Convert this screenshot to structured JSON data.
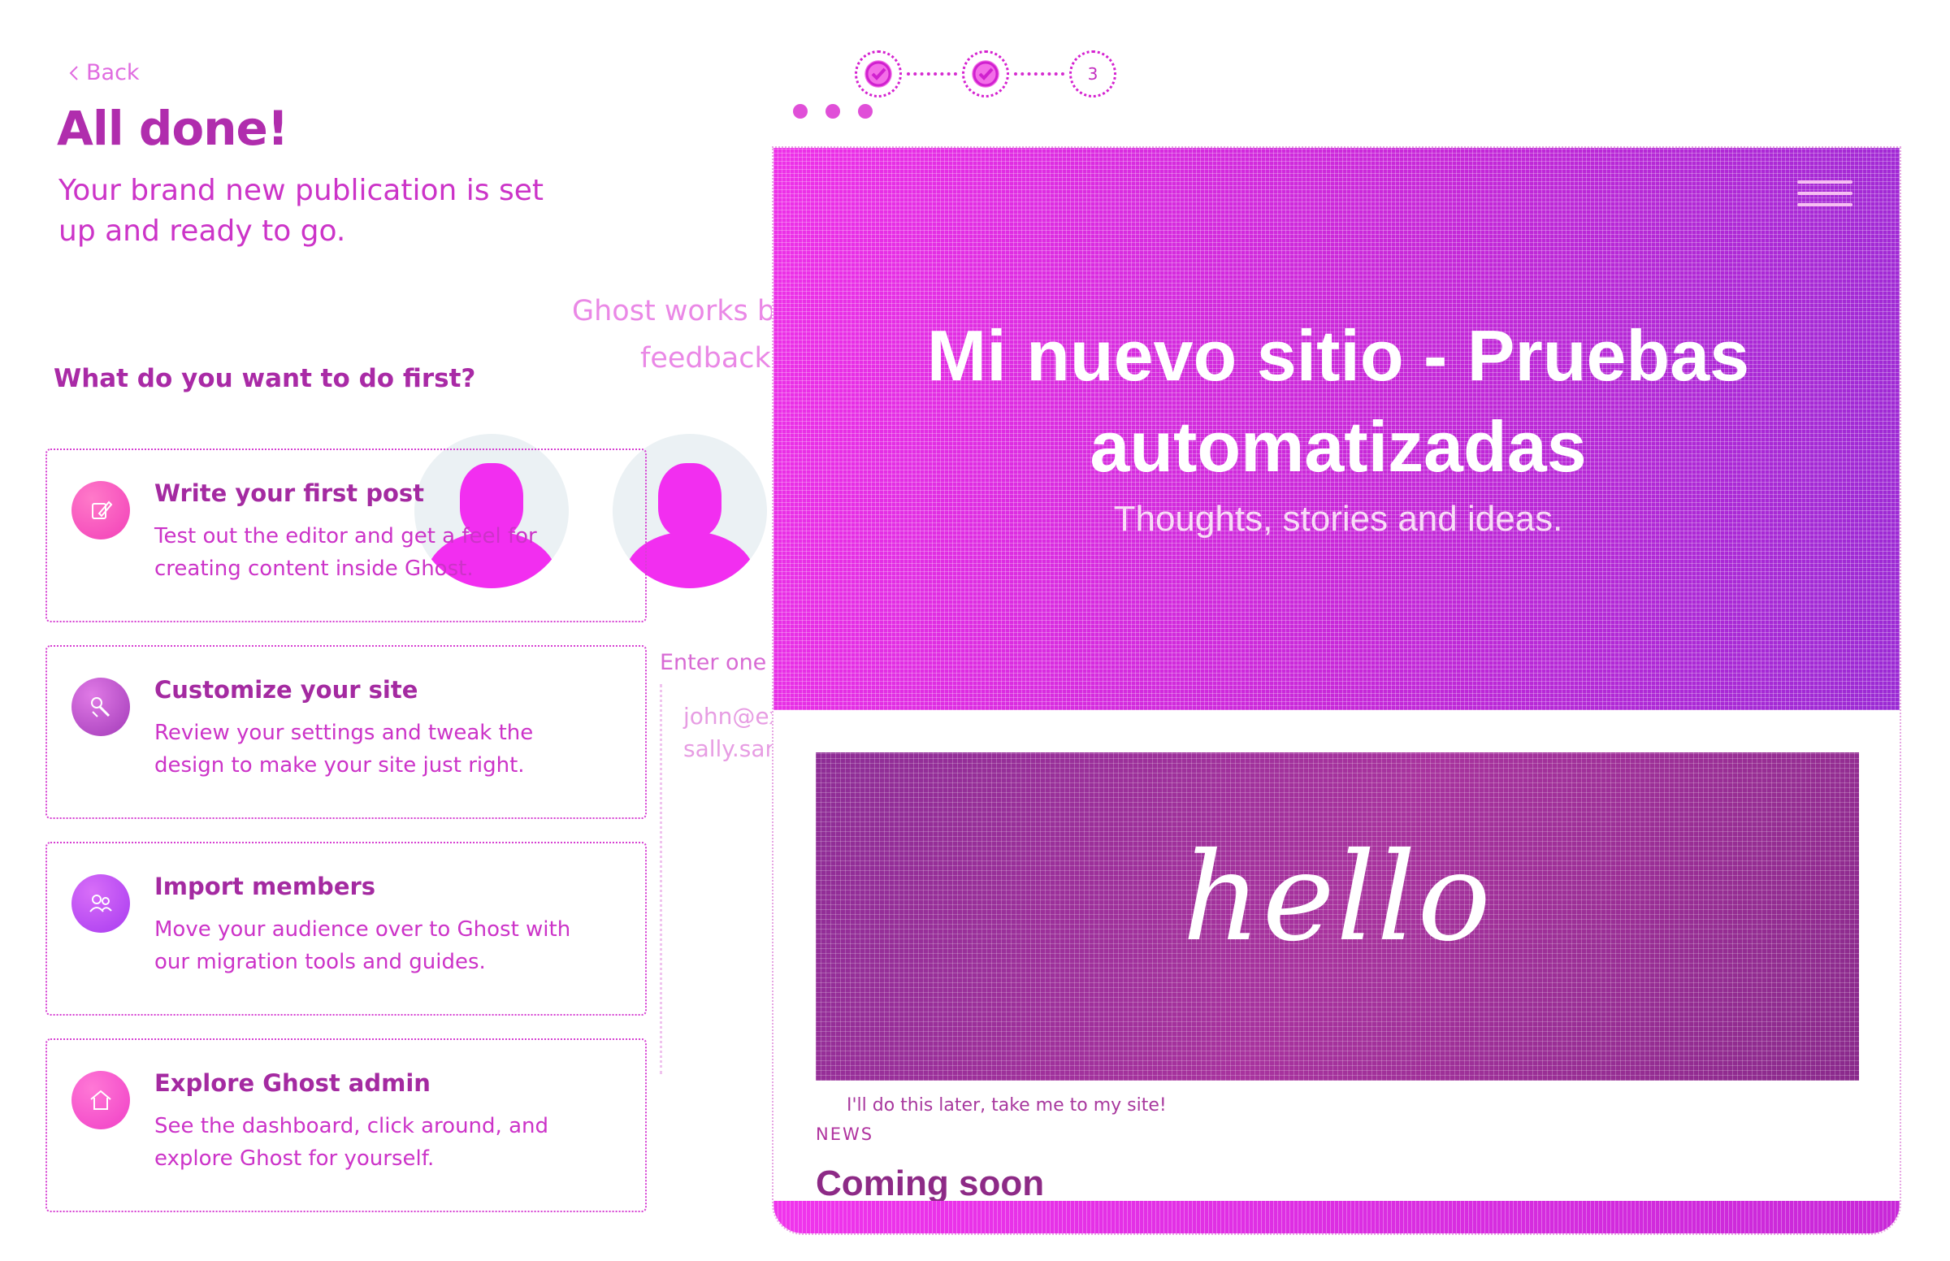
{
  "steps": [
    {
      "label": "1",
      "status": "done"
    },
    {
      "label": "2",
      "status": "done"
    },
    {
      "label": "3",
      "status": "current"
    }
  ],
  "back_label": "Back",
  "title": "All done!",
  "subtitle": "Your brand new publication is set up and ready to go.",
  "question": "What do you want to do first?",
  "cards": [
    {
      "title": "Write your first post",
      "desc": "Test out the editor and get a feel for creating content inside Ghost.",
      "icon": "pencil-icon",
      "color": "#f23fb8"
    },
    {
      "title": "Customize your site",
      "desc": "Review your settings and tweak the design to make your site just right.",
      "icon": "paint-brush-icon",
      "color": "#b53ec6"
    },
    {
      "title": "Import members",
      "desc": "Move your audience over to Ghost with our migration tools and guides.",
      "icon": "users-icon",
      "color": "#b83af3"
    },
    {
      "title": "Explore Ghost admin",
      "desc": "See the dashboard, click around, and explore Ghost for yourself.",
      "icon": "home-icon",
      "color": "#f23fc6"
    }
  ],
  "background": {
    "works_line1": "Ghost works b",
    "works_line2": "feedback",
    "enter_label": "Enter one",
    "emails": [
      "john@example.com",
      "sally.sanders@example.com"
    ]
  },
  "preview": {
    "site_title": "Mi nuevo sitio - Pruebas automatizadas",
    "tagline": "Thoughts, stories and ideas.",
    "feature_text": "hello",
    "later_link": "I'll do this later, take me to my site!",
    "post_tag": "NEWS",
    "post_title": "Coming soon"
  }
}
